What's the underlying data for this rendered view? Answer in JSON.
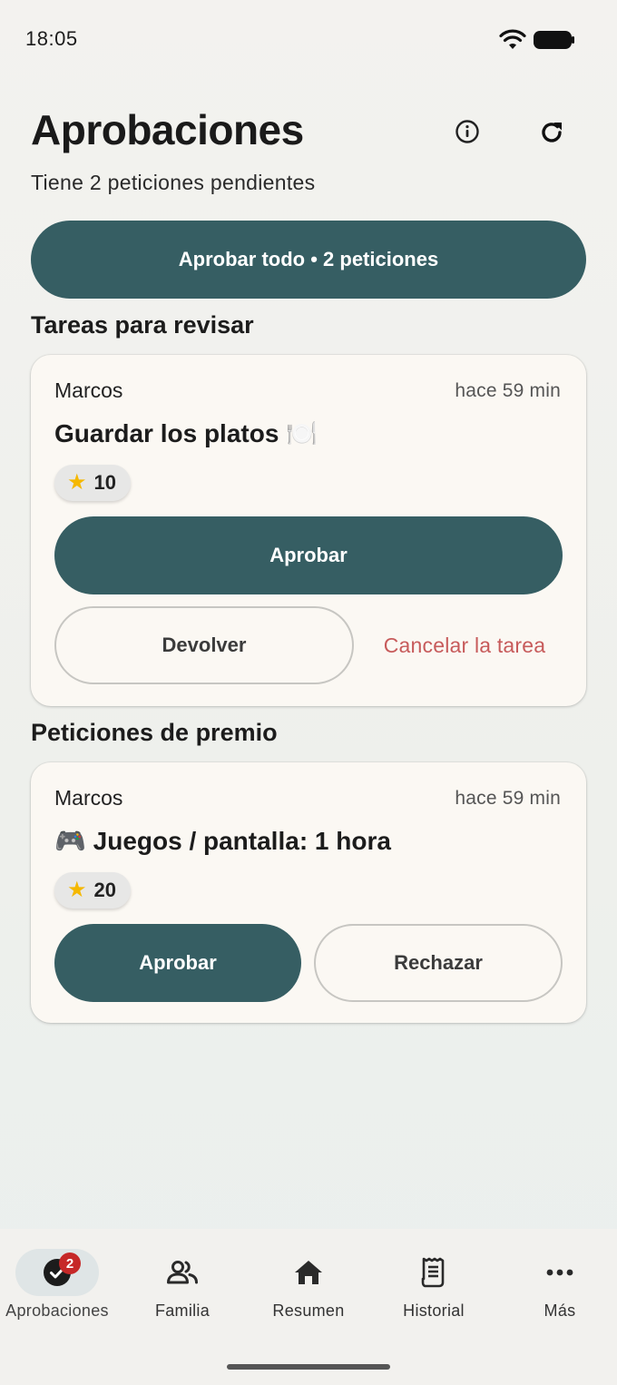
{
  "status_bar": {
    "time": "18:05"
  },
  "header": {
    "title": "Aprobaciones",
    "subtitle": "Tiene 2 peticiones pendientes"
  },
  "approve_all_label": "Aprobar todo • 2 peticiones",
  "tasks_section": {
    "title": "Tareas para revisar",
    "card": {
      "name": "Marcos",
      "time": "hace 59 min",
      "title": "Guardar los platos 🍽️",
      "points": "10",
      "approve_label": "Aprobar",
      "return_label": "Devolver",
      "cancel_label": "Cancelar la tarea"
    }
  },
  "rewards_section": {
    "title": "Peticiones de premio",
    "card": {
      "name": "Marcos",
      "time": "hace 59 min",
      "title": "🎮 Juegos / pantalla: 1 hora",
      "points": "20",
      "approve_label": "Aprobar",
      "reject_label": "Rechazar"
    }
  },
  "bottom_nav": {
    "items": [
      {
        "label": "Aprobaciones",
        "icon": "check-circle-icon",
        "badge": "2",
        "active": true
      },
      {
        "label": "Familia",
        "icon": "people-icon"
      },
      {
        "label": "Resumen",
        "icon": "home-icon"
      },
      {
        "label": "Historial",
        "icon": "receipt-icon"
      },
      {
        "label": "Más",
        "icon": "more-icon"
      }
    ]
  },
  "colors": {
    "primary": "#365e63",
    "danger_text": "#c75b5b",
    "badge": "#c62828",
    "star": "#f5b800"
  }
}
